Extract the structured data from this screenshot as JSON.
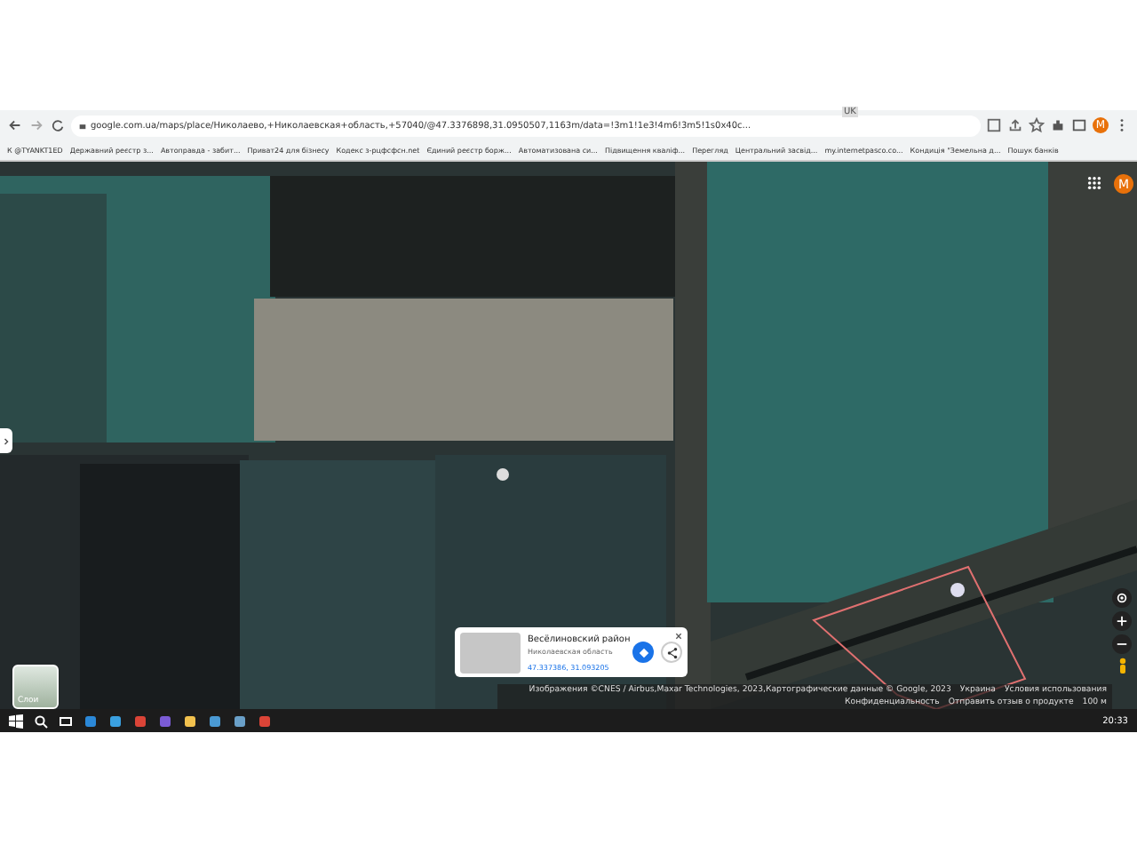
{
  "browser": {
    "badge": "UK",
    "url": "google.com.ua/maps/place/Николаево,+Николаевская+область,+57040/@47.3376898,31.0950507,1163m/data=!3m1!1e3!4m6!3m5!1s0x40c...",
    "profile_initial": "M"
  },
  "bookmarks": [
    {
      "label": "К @TYANKT1ED"
    },
    {
      "label": "Державний реєстр з..."
    },
    {
      "label": "Автоправда - забит..."
    },
    {
      "label": "Приват24 для бізнесу"
    },
    {
      "label": "Кодекс з-рцфсфсн.net"
    },
    {
      "label": "Єдиний реєстр борж..."
    },
    {
      "label": "Автоматизована си..."
    },
    {
      "label": "Підвищення кваліф..."
    },
    {
      "label": "Перегляд"
    },
    {
      "label": "Центральний засвід..."
    },
    {
      "label": "my.internetpasco.co..."
    },
    {
      "label": "Кондиція \"Земельна д..."
    },
    {
      "label": "Пошук банків"
    }
  ],
  "map": {
    "account_initial": "M"
  },
  "info_card": {
    "title": "Весёлиновский район",
    "subtitle": "Николаевская область",
    "coordinates": "47.337386, 31.093205"
  },
  "layers_button": {
    "label": "Слои"
  },
  "attribution": {
    "credit": "Изображения ©CNES / Airbus,Maxar Technologies, 2023,Картографические данные © Google, 2023",
    "links": [
      "Украина",
      "Условия использования",
      "Конфиденциальность",
      "Отправить отзыв о продукте"
    ],
    "scale": "100 м"
  },
  "taskbar": {
    "time": "20:33"
  }
}
